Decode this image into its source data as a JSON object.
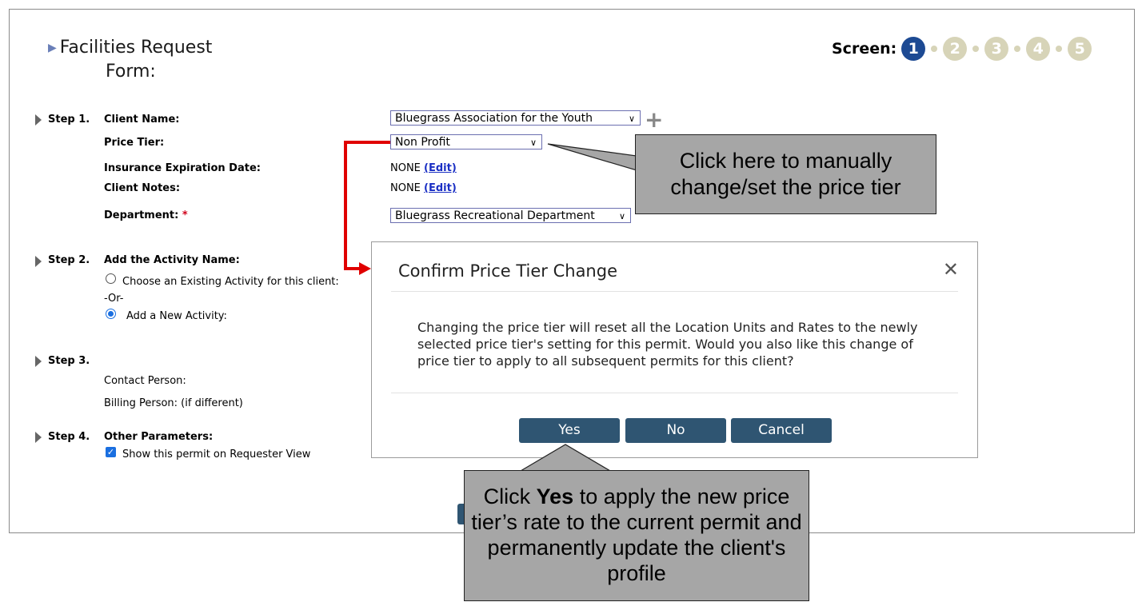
{
  "page": {
    "title_line1": "Facilities Request",
    "title_line2": "Form:"
  },
  "screen_nav": {
    "label": "Screen:",
    "steps": [
      "1",
      "2",
      "3",
      "4",
      "5"
    ],
    "active": "1"
  },
  "steps": {
    "step1": {
      "label": "Step 1.",
      "client_name_label": "Client Name:",
      "client_name_value": "Bluegrass Association for the Youth",
      "price_tier_label": "Price Tier:",
      "price_tier_value": "Non Profit",
      "insurance_label": "Insurance Expiration Date:",
      "insurance_value": "NONE",
      "client_notes_label": "Client Notes:",
      "client_notes_value": "NONE",
      "edit_link": "(Edit)",
      "department_label": "Department:",
      "department_required": "*",
      "department_value": "Bluegrass Recreational Department"
    },
    "step2": {
      "label": "Step 2.",
      "title": "Add the Activity Name:",
      "option_existing": "Choose an Existing Activity for this client:",
      "or_text": "-Or-",
      "option_new": "Add a New Activity:"
    },
    "step3": {
      "label": "Step 3.",
      "contact_person": "Contact Person:",
      "billing_person": "Billing Person: (if different)"
    },
    "step4": {
      "label": "Step 4.",
      "title": "Other Parameters:",
      "show_permit": "Show this permit on Requester View"
    }
  },
  "modal": {
    "title": "Confirm Price Tier Change",
    "close": "✕",
    "body": "Changing the price tier will reset all the Location Units and Rates to the newly selected price tier's setting for this permit. Would you also like this change of price tier to apply to all subsequent permits for this client?",
    "buttons": {
      "yes": "Yes",
      "no": "No",
      "cancel": "Cancel"
    }
  },
  "callouts": {
    "price_tier": "Click here to manually change/set the price tier",
    "yes_prefix": "Click",
    "yes_bold": "Yes",
    "yes_suffix": "to apply the new price tier’s rate to the current permit and permanently update the client's profile"
  },
  "colors": {
    "accent": "#2f5572",
    "active_step": "#1d4a93",
    "inactive_step": "#d7d4b8",
    "arrow_red": "#e00000",
    "callout_bg": "#a6a6a6"
  }
}
